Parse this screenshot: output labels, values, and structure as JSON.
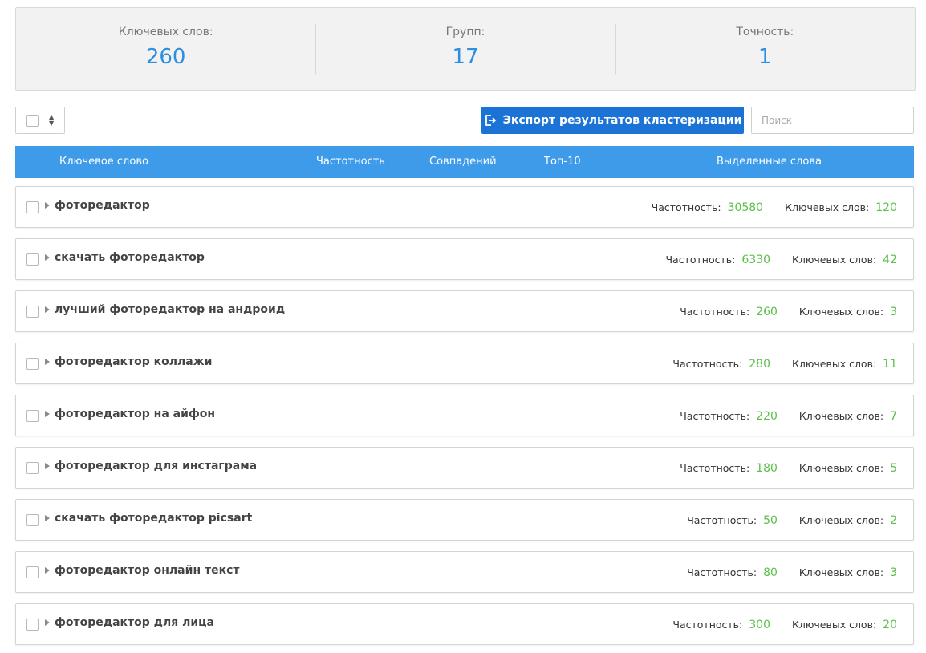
{
  "stats": [
    {
      "label": "Ключевых слов:",
      "value": "260"
    },
    {
      "label": "Групп:",
      "value": "17"
    },
    {
      "label": "Точность:",
      "value": "1"
    }
  ],
  "toolbar": {
    "export_label": "Экспорт результатов кластеризации",
    "search_placeholder": "Поиск"
  },
  "table": {
    "headers": {
      "keyword": "Ключевое слово",
      "frequency": "Частотность",
      "matches": "Совпадений",
      "top10": "Топ-10",
      "highlighted": "Выделенные слова"
    },
    "freq_label": "Частотность:",
    "kw_label": "Ключевых слов:",
    "rows": [
      {
        "keyword": "фоторедактор",
        "frequency": "30580",
        "keywords": "120"
      },
      {
        "keyword": "скачать фоторедактор",
        "frequency": "6330",
        "keywords": "42"
      },
      {
        "keyword": "лучший фоторедактор на андроид",
        "frequency": "260",
        "keywords": "3"
      },
      {
        "keyword": "фоторедактор коллажи",
        "frequency": "280",
        "keywords": "11"
      },
      {
        "keyword": "фоторедактор на айфон",
        "frequency": "220",
        "keywords": "7"
      },
      {
        "keyword": "фоторедактор для инстаграма",
        "frequency": "180",
        "keywords": "5"
      },
      {
        "keyword": "скачать фоторедактор picsart",
        "frequency": "50",
        "keywords": "2"
      },
      {
        "keyword": "фоторедактор онлайн текст",
        "frequency": "80",
        "keywords": "3"
      },
      {
        "keyword": "фоторедактор для лица",
        "frequency": "300",
        "keywords": "20"
      }
    ]
  },
  "colors": {
    "accent_blue": "#2e8fe0",
    "header_blue": "#3d9be9",
    "button_blue": "#1a73d5",
    "count_green": "#5bbf4a"
  },
  "icons": {
    "export": "export-icon",
    "sort": "sort-arrows-icon",
    "expand": "caret-right-icon"
  }
}
